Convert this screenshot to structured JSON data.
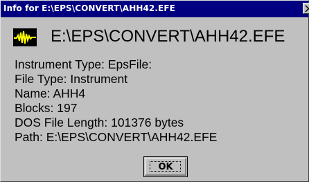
{
  "window": {
    "title": "Info for E:\\EPS\\CONVERT\\AHH42.EFE",
    "close_glyph": "×"
  },
  "header": {
    "icon": "waveform-icon",
    "path": "E:\\EPS\\CONVERT\\AHH42.EFE"
  },
  "info": {
    "lines": [
      "Instrument Type: EpsFile:",
      "File Type: Instrument",
      "Name: AHH4",
      "Blocks: 197",
      "DOS File Length: 101376 bytes",
      "Path: E:\\EPS\\CONVERT\\AHH42.EFE"
    ]
  },
  "buttons": {
    "ok_label": "OK"
  },
  "colors": {
    "titlebar": "#000080",
    "face": "#c0c0c0",
    "icon_wave": "#ffff00",
    "icon_bg": "#000000"
  }
}
